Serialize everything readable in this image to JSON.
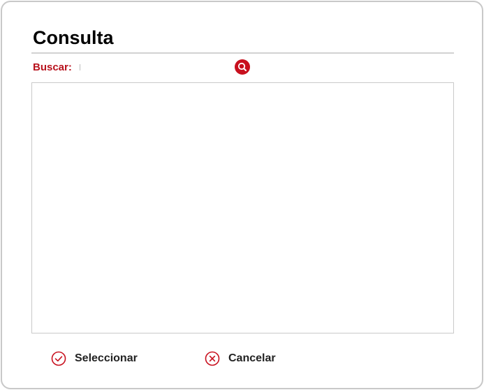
{
  "dialog": {
    "title": "Consulta"
  },
  "search": {
    "label": "Buscar:",
    "value": "",
    "placeholder": ""
  },
  "actions": {
    "select_label": "Seleccionar",
    "cancel_label": "Cancelar"
  },
  "icons": {
    "search": "magnifier-icon",
    "select": "check-circle-icon",
    "cancel": "x-circle-icon"
  },
  "colors": {
    "accent": "#c8101e",
    "label_text": "#b8121d",
    "border": "#c8c8c8"
  }
}
